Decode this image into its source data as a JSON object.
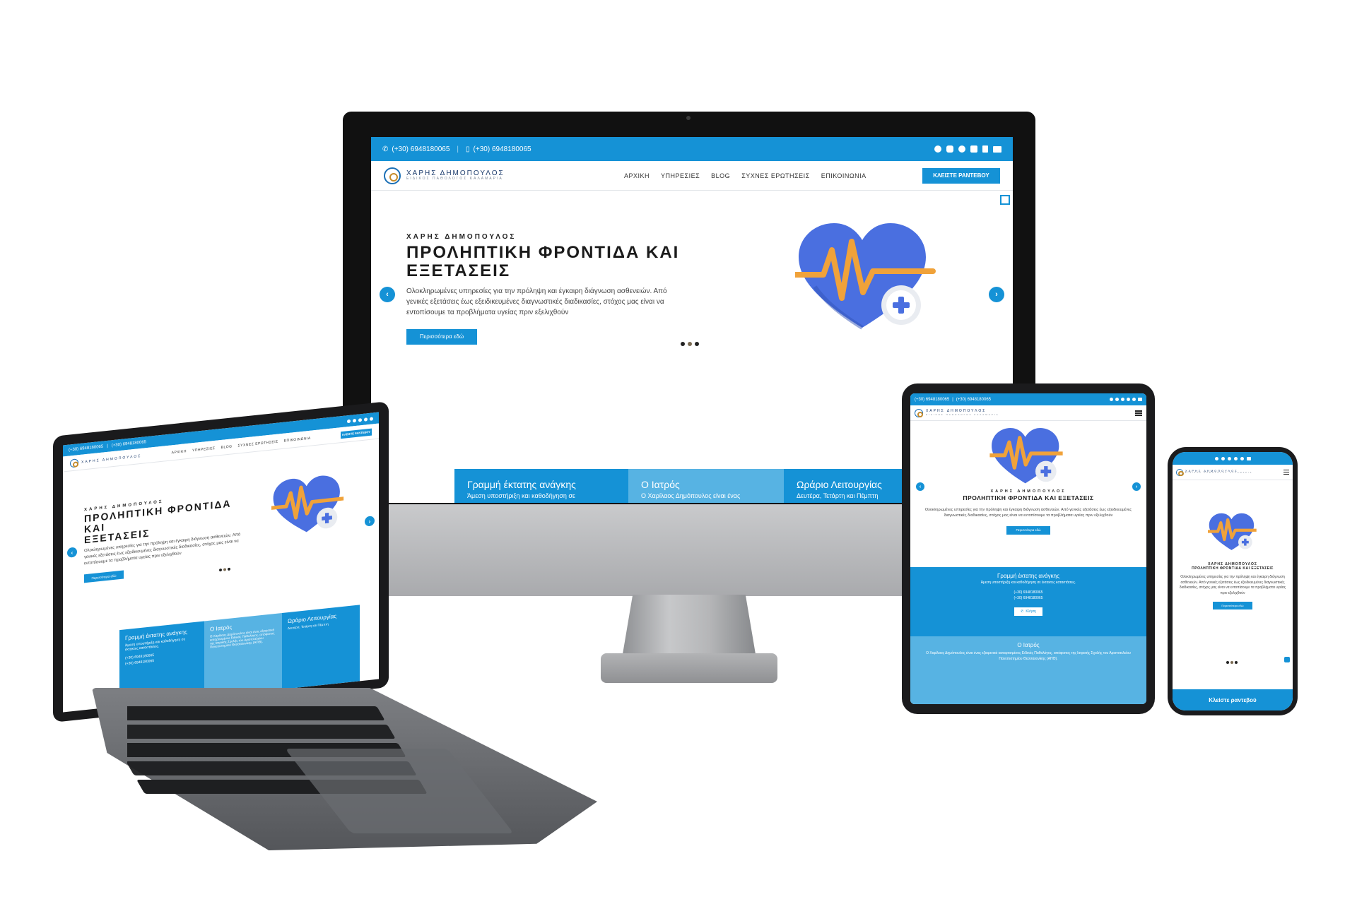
{
  "site": {
    "phone": "(+30) 6948180065",
    "mobile": "(+30) 6948180065",
    "brand_name": "ΧΑΡΗΣ ΔΗΜΟΠΟΥΛΟΣ",
    "brand_sub": "ΕΙΔΙΚΟΣ ΠΑΘΟΛΟΓΟΣ ΚΑΛΑΜΑΡΙΑ",
    "menu": [
      "ΑΡΧΙΚΗ",
      "ΥΠΗΡΕΣΙΕΣ",
      "BLOG",
      "ΣΥΧΝΕΣ ΕΡΩΤΗΣΕΙΣ",
      "ΕΠΙΚΟΙΝΩΝΙΑ"
    ],
    "cta": "ΚΛΕΙΣΤΕ ΡΑΝΤΕΒΟΥ",
    "socials": [
      "facebook-icon",
      "instagram-icon",
      "google-icon",
      "pinterest-icon",
      "tumblr-icon",
      "email-icon"
    ],
    "colors": {
      "primary": "#1592d6",
      "card_dark": "#1592d6",
      "card_light": "#57b3e3",
      "heart": "#4a6fe0",
      "pulse": "#f0a23a"
    }
  },
  "hero": {
    "eyebrow": "ΧΑΡΗΣ ΔΗΜΟΠΟΥΛΟΣ",
    "title_line1": "ΠΡΟΛΗΠΤΙΚΗ ΦΡΟΝΤΙΔΑ ΚΑΙ",
    "title_line2": "ΕΞΕΤΑΣΕΙΣ",
    "title_full": "ΠΡΟΛΗΠΤΙΚΗ ΦΡΟΝΤΙΔΑ ΚΑΙ ΕΞΕΤΑΣΕΙΣ",
    "desc_line1": "Ολοκληρωμένες υπηρεσίες για την πρόληψη και έγκαιρη διάγνωση ασθενειών. Από",
    "desc_line2": "γενικές εξετάσεις έως εξειδικευμένες διαγνωστικές διαδικασίες, στόχος μας είναι να",
    "desc_line3": "εντοπίσουμε τα προβλήματα υγείας πριν εξελιχθούν",
    "desc_full": "Ολοκληρωμένες υπηρεσίες για την πρόληψη και έγκαιρη διάγνωση ασθενειών. Από γενικές εξετάσεις έως εξειδικευμένες διαγνωστικές διαδικασίες, στόχος μας είναι να εντοπίσουμε τα προβλήματα υγείας πριν εξελιχθούν",
    "button": "Περισσότερα εδώ"
  },
  "cards": {
    "emergency_title": "Γραμμή έκτατης ανάγκης",
    "emergency_text": "Άμεση υποστήριξη και καθοδήγηση σε έκτακτες καταστάσεις.",
    "emergency_text_short": "Άμεση υποστήριξη και καθοδήγηση σε",
    "call": "Κλήση",
    "doctor_title": "Ο Ιατρός",
    "doctor_text": "Ο Χαρίλαος Δημόπουλος είναι ένας εξαιρετικά καταρτισμένος Ειδικός Παθολόγος, απόφοιτος της Ιατρικής Σχολής του Αριστοτελείου Πανεπιστημίου Θεσσαλονίκης (ΑΠΘ).",
    "doctor_text_short": "Ο Χαρίλαος Δημόπουλος είναι ένας",
    "hours_title": "Ωράριο Λειτουργίας",
    "hours_text": "Δευτέρα, Τετάρτη και Πέμπτη"
  },
  "phone_cta": "Κλείστε ραντεβού"
}
